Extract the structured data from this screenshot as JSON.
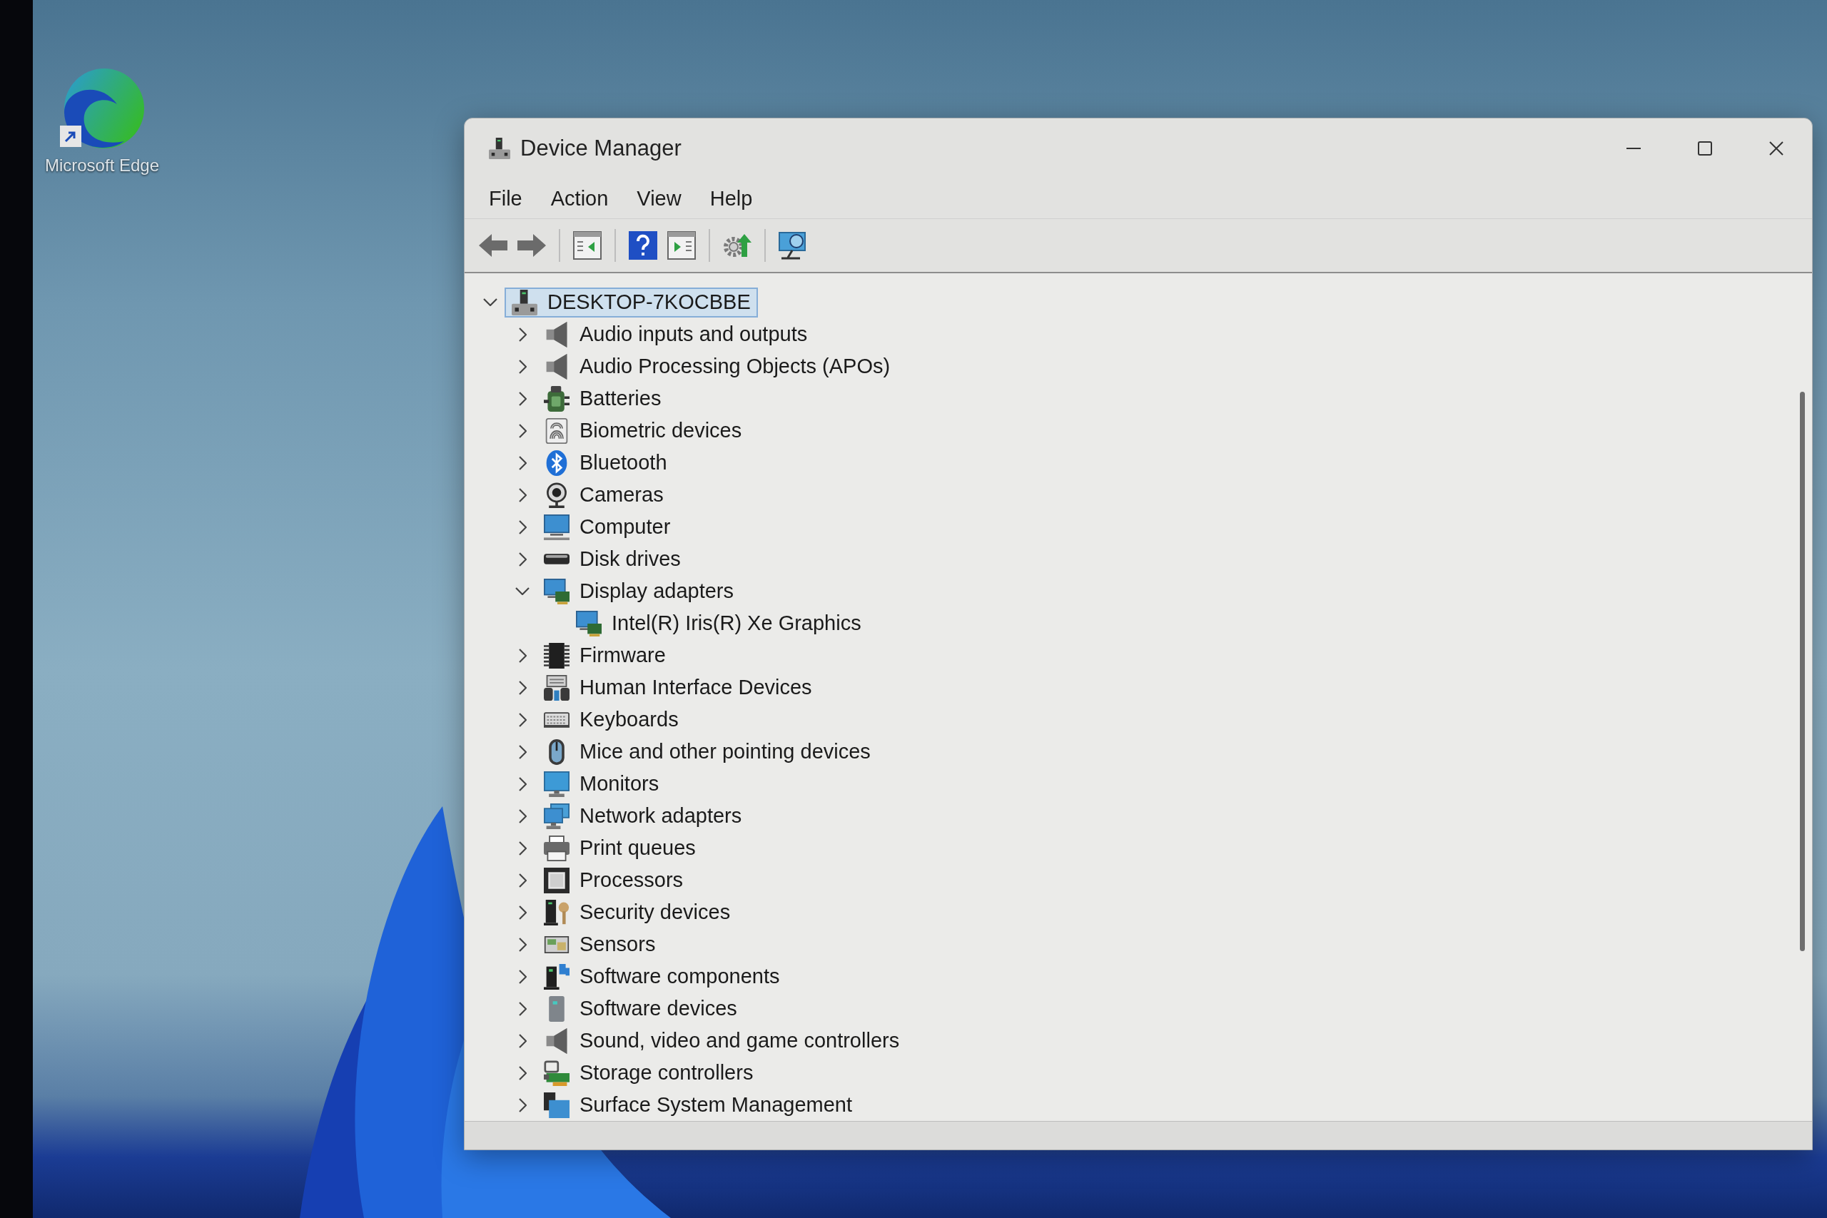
{
  "desktop": {
    "icons": [
      {
        "label": "Microsoft Edge"
      }
    ]
  },
  "window": {
    "title": "Device Manager",
    "menu": [
      "File",
      "Action",
      "View",
      "Help"
    ]
  },
  "tree": {
    "items": [
      {
        "label": "DESKTOP-7KOCBBE",
        "kind": "host",
        "selected": true,
        "expanded": true,
        "children": [
          {
            "label": "Audio inputs and outputs",
            "kind": "speaker",
            "selected": false,
            "expanded": false
          },
          {
            "label": "Audio Processing Objects (APOs)",
            "kind": "speaker",
            "selected": false,
            "expanded": false
          },
          {
            "label": "Batteries",
            "kind": "battery",
            "selected": false,
            "expanded": false
          },
          {
            "label": "Biometric devices",
            "kind": "fingerprint",
            "selected": false,
            "expanded": false
          },
          {
            "label": "Bluetooth",
            "kind": "bluetooth",
            "selected": false,
            "expanded": false
          },
          {
            "label": "Cameras",
            "kind": "webcam",
            "selected": false,
            "expanded": false
          },
          {
            "label": "Computer",
            "kind": "computer",
            "selected": false,
            "expanded": false
          },
          {
            "label": "Disk drives",
            "kind": "disk",
            "selected": false,
            "expanded": false
          },
          {
            "label": "Display adapters",
            "kind": "display",
            "selected": false,
            "expanded": true,
            "children": [
              {
                "label": "Intel(R) Iris(R) Xe Graphics",
                "kind": "display",
                "selected": false
              }
            ]
          },
          {
            "label": "Firmware",
            "kind": "chip",
            "selected": false,
            "expanded": false
          },
          {
            "label": "Human Interface Devices",
            "kind": "hid",
            "selected": false,
            "expanded": false
          },
          {
            "label": "Keyboards",
            "kind": "keyboard",
            "selected": false,
            "expanded": false
          },
          {
            "label": "Mice and other pointing devices",
            "kind": "mouse",
            "selected": false,
            "expanded": false
          },
          {
            "label": "Monitors",
            "kind": "monitor",
            "selected": false,
            "expanded": false
          },
          {
            "label": "Network adapters",
            "kind": "network",
            "selected": false,
            "expanded": false
          },
          {
            "label": "Print queues",
            "kind": "printer",
            "selected": false,
            "expanded": false
          },
          {
            "label": "Processors",
            "kind": "processor",
            "selected": false,
            "expanded": false
          },
          {
            "label": "Security devices",
            "kind": "security",
            "selected": false,
            "expanded": false
          },
          {
            "label": "Sensors",
            "kind": "sensor",
            "selected": false,
            "expanded": false
          },
          {
            "label": "Software components",
            "kind": "component",
            "selected": false,
            "expanded": false
          },
          {
            "label": "Software devices",
            "kind": "tower",
            "selected": false,
            "expanded": false
          },
          {
            "label": "Sound, video and game controllers",
            "kind": "speaker",
            "selected": false,
            "expanded": false
          },
          {
            "label": "Storage controllers",
            "kind": "storage",
            "selected": false,
            "expanded": false
          },
          {
            "label": "Surface System Management",
            "kind": "surface",
            "selected": false,
            "expanded": false
          }
        ]
      }
    ]
  }
}
